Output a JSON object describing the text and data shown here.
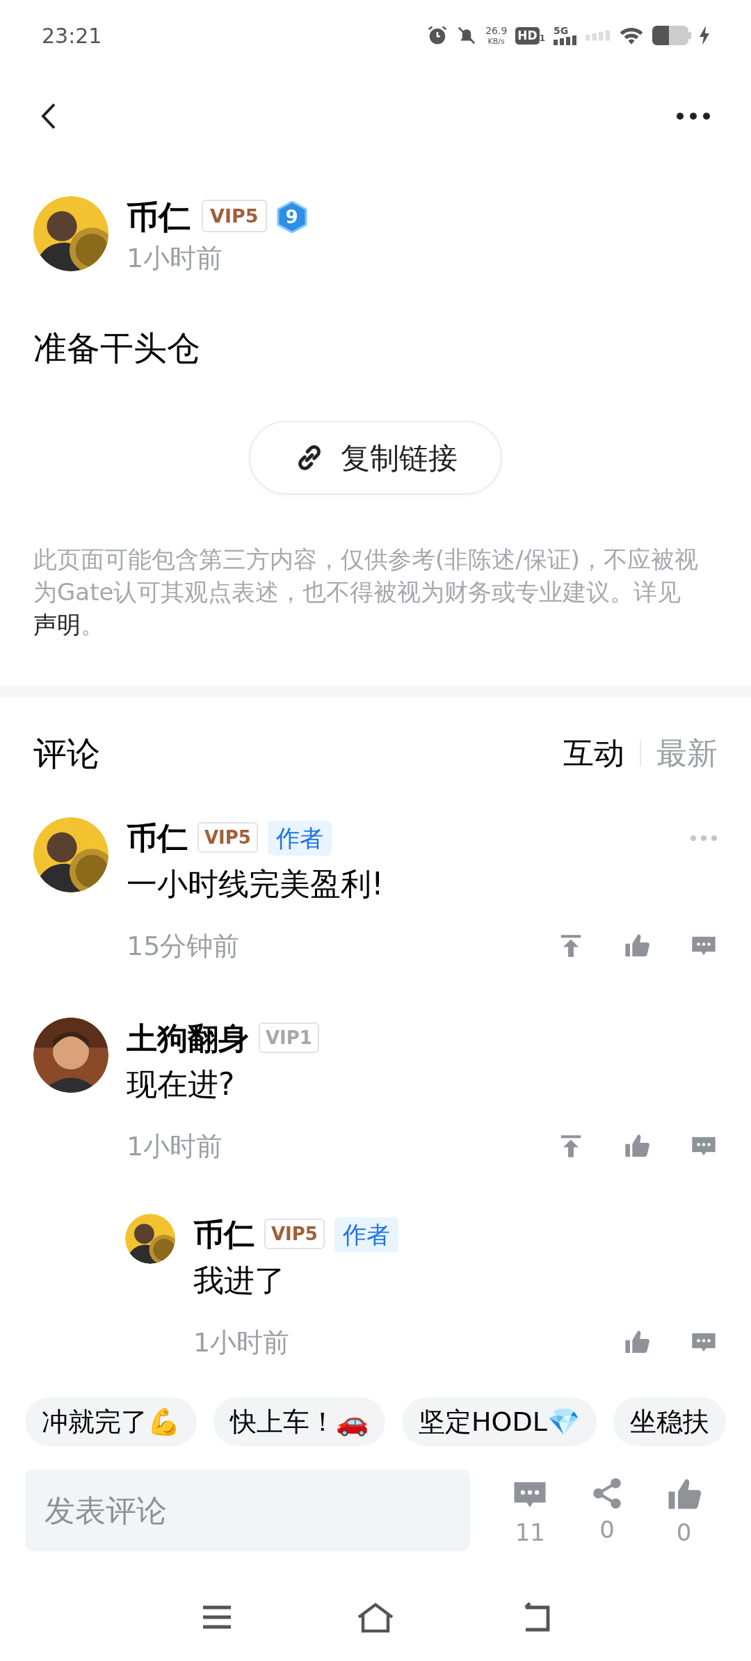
{
  "status_bar": {
    "time": "23:21",
    "net_speed": "26.9",
    "net_unit": "KB/s",
    "hd": "HD",
    "hd_sim": "1",
    "network": "5G"
  },
  "post": {
    "author": {
      "name": "币仁",
      "vip": {
        "label": "VIP5",
        "color": "#a0603a"
      },
      "level": "9"
    },
    "time": "1小时前",
    "body": "准备干头仓",
    "copy_link": "复制链接",
    "disclaimer": "此页面可能包含第三方内容，仅供参考(非陈述/保证)，不应被视为Gate认可其观点表述，也不得被视为财务或专业建议。详见",
    "disclaimer_link": "声明",
    "disclaimer_end": "。"
  },
  "comments_section": {
    "title": "评论",
    "sort_tabs": [
      {
        "label": "互动",
        "selected": true
      },
      {
        "label": "最新",
        "selected": false
      }
    ]
  },
  "comments": [
    {
      "kind": "comment",
      "name": "币仁",
      "vip": {
        "label": "VIP5",
        "color": "#a0603a"
      },
      "author_tag": "作者",
      "body": "一小时线完美盈利!",
      "time": "15分钟前",
      "more": true,
      "can_pin": true
    },
    {
      "kind": "comment",
      "name": "土狗翻身",
      "vip": {
        "label": "VIP1",
        "color": "#a8a8a8"
      },
      "body": "现在进?",
      "time": "1小时前",
      "more": false,
      "can_pin": true
    },
    {
      "kind": "reply",
      "name": "币仁",
      "vip": {
        "label": "VIP5",
        "color": "#a0603a"
      },
      "author_tag": "作者",
      "body": "我进了",
      "time": "1小时前",
      "more": false,
      "can_pin": false
    }
  ],
  "quick_replies": [
    "冲就完了💪",
    "快上车！🚗",
    "坚定HODL💎",
    "坐稳扶"
  ],
  "composer": {
    "placeholder": "发表评论",
    "comments_count": "11",
    "shares_count": "0",
    "likes_count": "0"
  }
}
